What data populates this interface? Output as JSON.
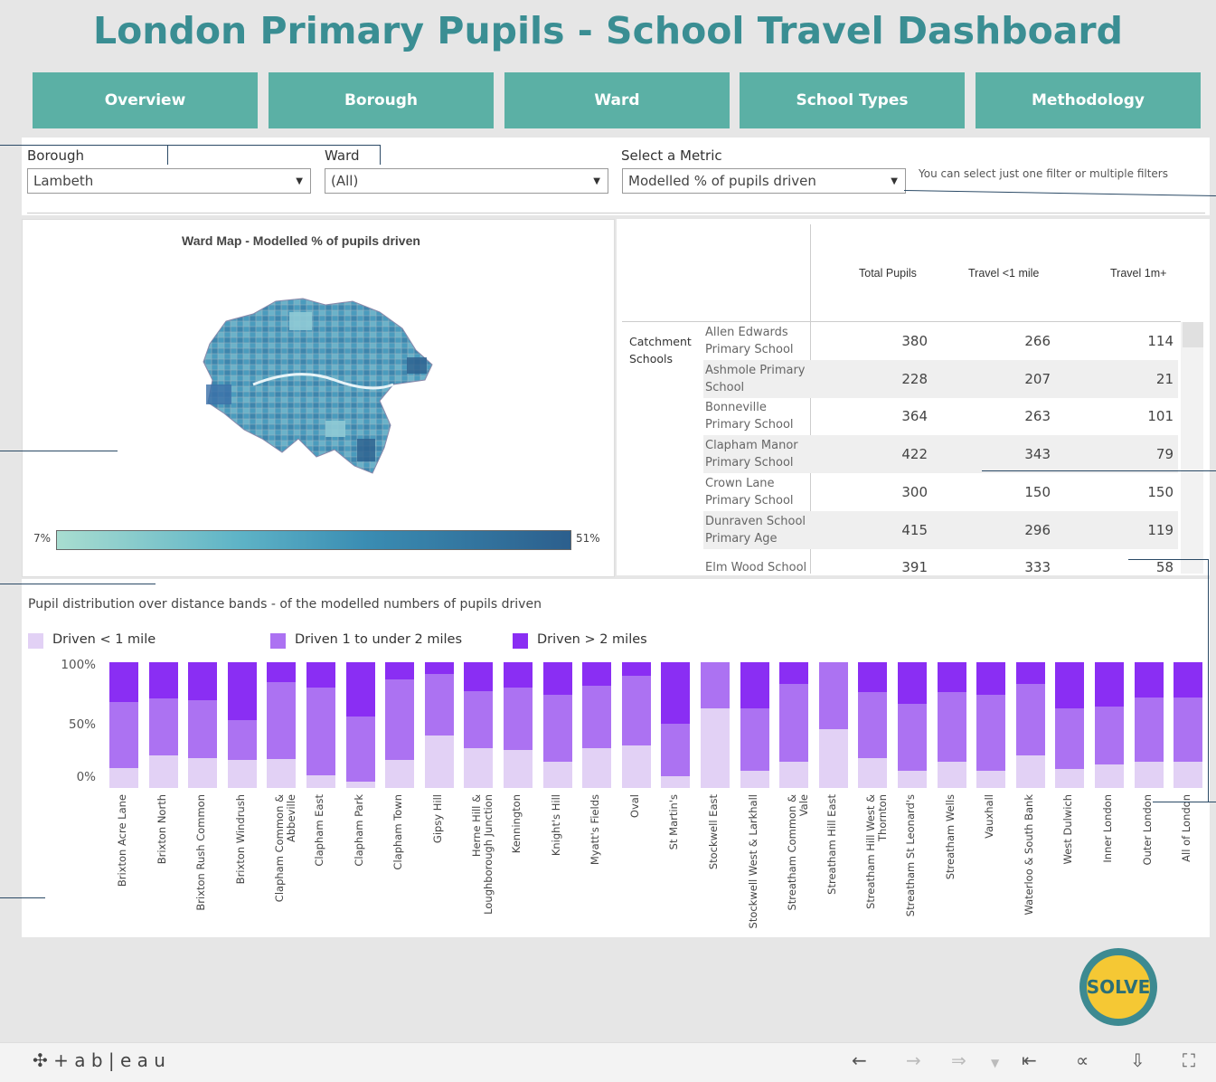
{
  "title": "London Primary Pupils - School Travel Dashboard",
  "nav": [
    "Overview",
    "Borough",
    "Ward",
    "School Types",
    "Methodology"
  ],
  "filters": {
    "borough_label": "Borough",
    "borough_value": "Lambeth",
    "ward_label": "Ward",
    "ward_value": "(All)",
    "metric_label": "Select a Metric",
    "metric_value": "Modelled % of pupils driven",
    "hint": "You can select just one filter or multiple filters"
  },
  "map": {
    "title": "Ward Map - Modelled % of pupils driven",
    "legend_min": "7%",
    "legend_max": "51%"
  },
  "table": {
    "headers": [
      "Total Pupils",
      "Travel <1 mile",
      "Travel 1m+"
    ],
    "group": "Catchment Schools",
    "rows": [
      {
        "name": "Allen Edwards Primary School",
        "total": "380",
        "lt1": "266",
        "gt1": "114"
      },
      {
        "name": "Ashmole Primary School",
        "total": "228",
        "lt1": "207",
        "gt1": "21"
      },
      {
        "name": "Bonneville Primary School",
        "total": "364",
        "lt1": "263",
        "gt1": "101"
      },
      {
        "name": "Clapham Manor Primary School",
        "total": "422",
        "lt1": "343",
        "gt1": "79"
      },
      {
        "name": "Crown Lane Primary School",
        "total": "300",
        "lt1": "150",
        "gt1": "150"
      },
      {
        "name": "Dunraven School Primary Age",
        "total": "415",
        "lt1": "296",
        "gt1": "119"
      },
      {
        "name": "Elm Wood School",
        "total": "391",
        "lt1": "333",
        "gt1": "58"
      }
    ]
  },
  "chart_data": {
    "type": "bar",
    "stacked": true,
    "title": "Pupil distribution over distance bands - of the modelled numbers of pupils driven",
    "legend_position": "top-left",
    "yticks": [
      "100%",
      "50%",
      "0%"
    ],
    "ylim": [
      0,
      100
    ],
    "categories": [
      "Brixton Acre Lane",
      "Brixton North",
      "Brixton Rush Common",
      "Brixton Windrush",
      "Clapham Common & Abbeville",
      "Clapham East",
      "Clapham Park",
      "Clapham Town",
      "Gipsy Hill",
      "Herne Hill & Loughborough Junction",
      "Kennington",
      "Knight's Hill",
      "Myatt's Fields",
      "Oval",
      "St Martin's",
      "Stockwell East",
      "Stockwell West & Larkhall",
      "Streatham Common & Vale",
      "Streatham Hill East",
      "Streatham Hill West & Thornton",
      "Streatham St Leonard's",
      "Streatham Wells",
      "Vauxhall",
      "Waterloo & South Bank",
      "West Dulwich",
      "Inner London",
      "Outer London",
      "All of London"
    ],
    "series": [
      {
        "name": "Driven < 1 mile",
        "color": "#e2d1f5",
        "values": [
          16,
          26,
          24,
          22,
          23,
          10,
          5,
          22,
          42,
          32,
          30,
          21,
          32,
          34,
          9,
          63,
          14,
          21,
          47,
          24,
          14,
          21,
          14,
          26,
          15,
          19,
          21,
          21
        ]
      },
      {
        "name": "Driven 1 to under 2 miles",
        "color": "#ac72f2",
        "values": [
          52,
          45,
          46,
          32,
          61,
          70,
          52,
          64,
          49,
          45,
          50,
          53,
          49,
          55,
          42,
          37,
          49,
          62,
          53,
          52,
          53,
          55,
          60,
          57,
          48,
          46,
          51,
          51
        ]
      },
      {
        "name": "Driven > 2 miles",
        "color": "#8a2ef3",
        "values": [
          32,
          29,
          30,
          46,
          16,
          20,
          43,
          14,
          9,
          23,
          20,
          26,
          19,
          11,
          49,
          0,
          37,
          17,
          0,
          24,
          33,
          24,
          26,
          17,
          37,
          35,
          28,
          28
        ]
      }
    ]
  },
  "toolbar": {
    "brand": "+ a b | e a u",
    "icons": [
      "undo-icon",
      "redo-icon",
      "revert-icon",
      "reset-icon",
      "share-icon",
      "download-icon",
      "fullscreen-icon"
    ]
  },
  "logo_text": "SOLVE"
}
